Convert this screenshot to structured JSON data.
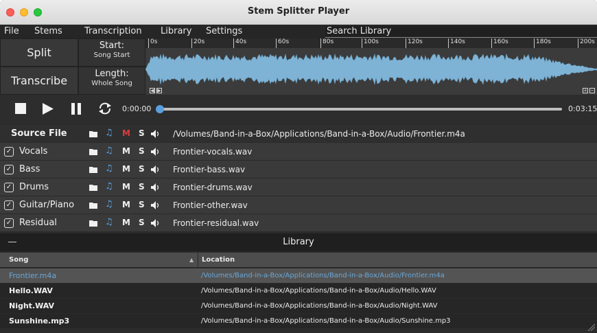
{
  "window": {
    "title": "Stem Splitter Player"
  },
  "menu": {
    "items": [
      "File",
      "Stems",
      "Transcription",
      "Library",
      "Settings"
    ],
    "search_label": "Search Library"
  },
  "controls": {
    "split_label": "Split",
    "transcribe_label": "Transcribe",
    "start_label": "Start:",
    "start_value": "Song Start",
    "length_label": "Length:",
    "length_value": "Whole Song"
  },
  "ruler": [
    "0s",
    "20s",
    "40s",
    "60s",
    "80s",
    "100s",
    "120s",
    "140s",
    "160s",
    "180s",
    "200s"
  ],
  "transport": {
    "current_time": "0:00:00",
    "total_time": "0:03:15",
    "position": 0.0
  },
  "source": {
    "label": "Source File",
    "path": "/Volumes/Band-in-a-Box/Applications/Band-in-a-Box/Audio/Frontier.m4a"
  },
  "stems": [
    {
      "name": "Vocals",
      "file": "Frontier-vocals.wav",
      "checked": true
    },
    {
      "name": "Bass",
      "file": "Frontier-bass.wav",
      "checked": true
    },
    {
      "name": "Drums",
      "file": "Frontier-drums.wav",
      "checked": true
    },
    {
      "name": "Guitar/Piano",
      "file": "Frontier-other.wav",
      "checked": true
    },
    {
      "name": "Residual",
      "file": "Frontier-residual.wav",
      "checked": true
    }
  ],
  "row_buttons": {
    "mute": "M",
    "solo": "S"
  },
  "library": {
    "title": "Library",
    "columns": [
      "Song",
      "Location"
    ],
    "rows": [
      {
        "song": "Frontier.m4a",
        "location": "/Volumes/Band-in-a-Box/Applications/Band-in-a-Box/Audio/Frontier.m4a",
        "selected": true
      },
      {
        "song": "Hello.WAV",
        "location": "/Volumes/Band-in-a-Box/Applications/Band-in-a-Box/Audio/Hello.WAV",
        "selected": false
      },
      {
        "song": "Night.WAV",
        "location": "/Volumes/Band-in-a-Box/Applications/Band-in-a-Box/Audio/Night.WAV",
        "selected": false
      },
      {
        "song": "Sunshine.mp3",
        "location": "/Volumes/Band-in-a-Box/Applications/Band-in-a-Box/Audio/Sunshine.mp3",
        "selected": false
      }
    ]
  },
  "colors": {
    "accent": "#5aa0e0",
    "waveform": "#7fb3d5",
    "mute_active": "#e23a3a"
  }
}
